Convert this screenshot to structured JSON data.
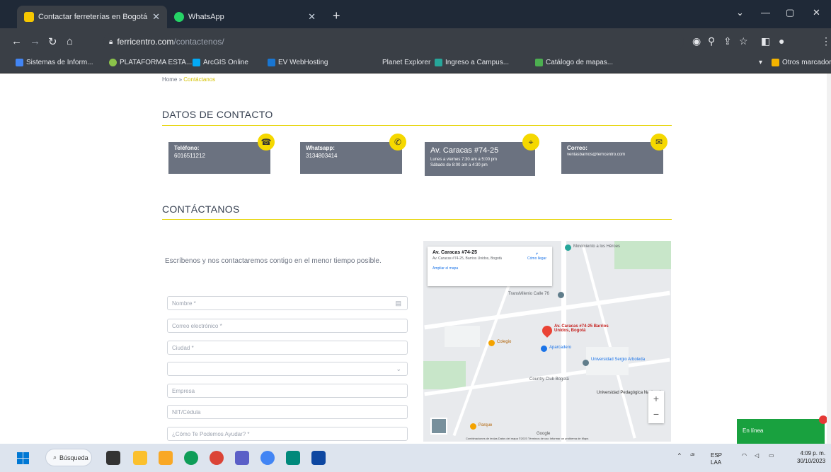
{
  "browser": {
    "tabs": [
      {
        "title": "Contactar ferreterías en Bogotá",
        "close": "✕"
      },
      {
        "title": "WhatsApp",
        "close": "✕"
      }
    ],
    "new_tab": "+",
    "window_controls": {
      "chevron": "⌄",
      "minimize": "—",
      "restore": "▢",
      "close": "✕"
    },
    "url_host": "ferricentro.com",
    "url_path": "/contactenos/",
    "bookmarks": [
      "Sistemas de Inform...",
      "PLATAFORMA ESTA...",
      "ArcGIS Online",
      "EV WebHosting",
      "Planet Explorer",
      "Ingreso a Campus...",
      "Catálogo de mapas..."
    ],
    "bookmarks_other": "Otros marcadores"
  },
  "page": {
    "breadcrumb_home": "Home",
    "breadcrumb_sep": "»",
    "breadcrumb_current": "Contáctanos",
    "contact_title": "DATOS DE CONTACTO",
    "cards": [
      {
        "label": "Teléfono:",
        "value": "6016511212",
        "badge": "☎"
      },
      {
        "label": "Whatsapp:",
        "value": "3134803414",
        "badge": "✆"
      },
      {
        "label": "Av. Caracas #74-25",
        "value": "Lunes a viernes 7:30 am a 5:00 pm",
        "sub": "Sábado de 8:00 am a 4:30 pm",
        "badge": "⌖"
      },
      {
        "label": "Correo:",
        "value": "ventasbarrios@ferricentro.com",
        "badge": "✉"
      }
    ],
    "form_title": "CONTÁCTANOS",
    "intro": "Escríbenos y nos contactaremos contigo en el menor tiempo posible.",
    "fields": [
      {
        "placeholder": "Nombre *",
        "trail": "▤"
      },
      {
        "placeholder": "Correo electrónico *",
        "trail": ""
      },
      {
        "placeholder": "Ciudad *",
        "trail": ""
      },
      {
        "placeholder": "",
        "trail": "⌄"
      },
      {
        "placeholder": "Empresa",
        "trail": ""
      },
      {
        "placeholder": "NIT/Cédula",
        "trail": ""
      },
      {
        "placeholder": "¿Cómo Te Podemos Ayudar? *",
        "trail": ""
      }
    ]
  },
  "map": {
    "card_title": "Av. Caracas #74-25",
    "card_address": "Av. Caracas #74-25, Barrios Unidos, Bogotá",
    "card_link": "Ampliar el mapa",
    "directions": "Cómo llegar",
    "pin_label": "Av. Caracas #74-25 Barrios Unidos, Bogotá",
    "pois": [
      "Movimiento a los Héroes",
      "TransMilenio Calle 76",
      "Universidad Sergio Arboleda",
      "Universidad Pedagógica Nacional",
      "Country Club Bogotá",
      "Aparcadero",
      "Colegio",
      "Parque"
    ],
    "zoom_in": "+",
    "zoom_out": "−",
    "footer": "Combinaciones de teclas   Datos del mapa ©2023   Términos de uso   Informar un problema de Maps",
    "logo": "Google"
  },
  "chat": {
    "label": "En línea"
  },
  "taskbar": {
    "search": "Búsqueda",
    "lang": "ESP",
    "lang2": "LAA",
    "time": "4:09 p. m.",
    "date": "30/10/2023"
  },
  "colors": {
    "accent": "#f5d800",
    "card_bg": "#6b7280",
    "online": "#19a13f"
  }
}
